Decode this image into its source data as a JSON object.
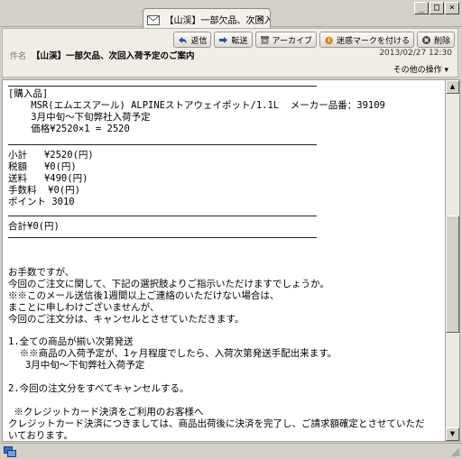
{
  "window": {
    "tab_title": "【山渓】一部欠品、次回入荷...",
    "tab_close": "×",
    "minimize": "_",
    "maximize": "□",
    "close": "×"
  },
  "toolbar": {
    "reply": "返信",
    "forward": "転送",
    "archive": "アーカイブ",
    "junk": "迷惑マークを付ける",
    "delete": "削除"
  },
  "header": {
    "subject_label": "件名",
    "subject": "【山渓】一部欠品、次回入荷予定のご案内",
    "date": "2013/02/27 12:30",
    "other_actions": "その他の操作 ▾"
  },
  "message": {
    "purchase_block": "[購入品]\n    MSR(エムエスアール) ALPINEストアウェイポット/1.1L  メーカー品番：39109\n    3月中旬～下旬弊社入荷予定\n    価格¥2520×1 = 2520",
    "totals_block": "小計   ¥2520(円)\n税額   ¥0(円)\n送料   ¥490(円)\n手数料  ¥0(円)\nポイント 3010",
    "total_line": "合計¥0(円)",
    "notice_block": "お手数ですが、\n今回のご注文に関して、下記の選択肢よりご指示いただけますでしょうか。\n※※このメール送信後1週間以上ご連絡のいただけない場合は、\nまことに申しわけございませんが、\n今回のご注文分は、キャンセルとさせていただきます。\n\n1.全ての商品が揃い次第発送\n  ※※商品の入荷予定が、1ヶ月程度でしたら、入荷次第発送手配出来ます。\n   3月中旬～下旬弊社入荷予定\n\n2.今回の注文分をすべてキャンセルする。\n\n ※クレジットカード決済をご利用のお客様へ\nクレジットカード決済につきましては、商品出荷後に決済を完了し、ご請求額確定とさせていただ\nいております。"
  },
  "scrollbar": {
    "up": "▲",
    "down": "▼"
  },
  "colors": {
    "chrome": "#d4d0c8",
    "header_bg": "#f0ede6",
    "body_bg": "#ffffff"
  }
}
